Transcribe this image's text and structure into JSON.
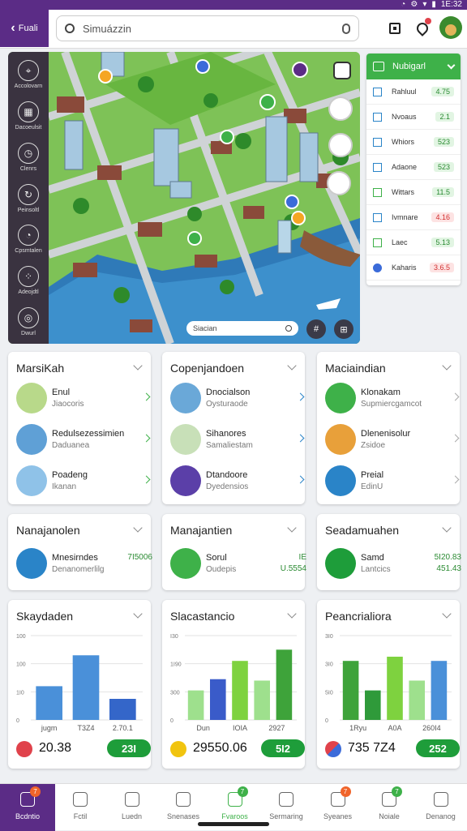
{
  "status": {
    "time": "1E:32"
  },
  "topbar": {
    "back_label": "Fuali",
    "search_placeholder": "Simuázzin"
  },
  "left_rail": [
    {
      "label": "Accolovarn",
      "icon": "compass-icon"
    },
    {
      "label": "Dacoeulsit",
      "icon": "grid-icon"
    },
    {
      "label": "Clenrs",
      "icon": "clock-icon"
    },
    {
      "label": "Peinsoltl",
      "icon": "refresh-icon"
    },
    {
      "label": "Cpsmtalen",
      "icon": "chart-icon"
    },
    {
      "label": "Adeojdtl",
      "icon": "apps-icon"
    },
    {
      "label": "Dwurl",
      "icon": "bell-icon"
    }
  ],
  "map": {
    "search_label": "Siacian"
  },
  "right_panel": {
    "title": "Nubigarl",
    "rows": [
      {
        "label": "Rahluul",
        "value": "4.75",
        "color": "green"
      },
      {
        "label": "Nvoaus",
        "value": "2.1",
        "color": "green"
      },
      {
        "label": "Whiors",
        "value": "523",
        "color": "green"
      },
      {
        "label": "Adaone",
        "value": "523",
        "color": "green"
      },
      {
        "label": "Wittars",
        "value": "11.5",
        "color": "green"
      },
      {
        "label": "Ivmnare",
        "value": "4.16",
        "color": "red"
      },
      {
        "label": "Laec",
        "value": "5.13",
        "color": "green"
      },
      {
        "label": "Kaharis",
        "value": "3.6.5",
        "color": "red"
      }
    ]
  },
  "cards_row1": [
    {
      "title": "MarsiKah",
      "items": [
        {
          "t1": "Enul",
          "t2": "Jiaocoris"
        },
        {
          "t1": "Redulsezessimien",
          "t2": "Daduanea"
        },
        {
          "t1": "Poadeng",
          "t2": "Ikanan"
        }
      ]
    },
    {
      "title": "Copenjandoen",
      "items": [
        {
          "t1": "Dnocialson",
          "t2": "Oysturaode"
        },
        {
          "t1": "Sihanores",
          "t2": "Samaliestam"
        },
        {
          "t1": "Dtandoore",
          "t2": "Dyedensios"
        }
      ]
    },
    {
      "title": "Maciaindian",
      "items": [
        {
          "t1": "Klonakam",
          "t2": "Supmiercgamcot"
        },
        {
          "t1": "Dlenenisolur",
          "t2": "Zsidoe"
        },
        {
          "t1": "Preial",
          "t2": "EdinU"
        }
      ]
    }
  ],
  "cards_row2": [
    {
      "title": "Nanajanolen",
      "t1": "Mnesirndes",
      "t2": "Denanomerlilg",
      "v1": "7I5006",
      "v2": ""
    },
    {
      "title": "Manajantien",
      "t1": "Sorul",
      "t2": "Oudepis",
      "v1": "IE",
      "v2": "U.5554"
    },
    {
      "title": "Seadamuahen",
      "t1": "Samd",
      "t2": "Lantcics",
      "v1": "5I20.83",
      "v2": "451.43"
    }
  ],
  "charts": [
    {
      "title": "Skaydaden",
      "stat": "20.38",
      "pill": "23I",
      "dot_color": "#e0424b"
    },
    {
      "title": "Slacastancio",
      "stat": "29550.06",
      "pill": "5I2",
      "dot_color": "#f1c40f"
    },
    {
      "title": "Peancrialiora",
      "stat": "735  7Z4",
      "pill": "252",
      "dot_color": "#e0424b"
    }
  ],
  "chart_data": [
    {
      "type": "bar",
      "title": "Skaydaden",
      "categories": [
        "jugm",
        "T3Z4",
        "2.70.1"
      ],
      "values": [
        120,
        230,
        75
      ],
      "yticks": [
        "0",
        "1I0",
        "100",
        "100"
      ],
      "ylim": [
        0,
        300
      ],
      "colors": [
        "#4a90d9",
        "#4a90d9",
        "#3466c9"
      ]
    },
    {
      "type": "bar",
      "title": "Slacastancio",
      "categories": [
        "Dun",
        "IOIA",
        "2927"
      ],
      "values": [
        105,
        145,
        210,
        140,
        250
      ],
      "yticks": [
        "0",
        "300",
        "1I90",
        "I30"
      ],
      "ylim": [
        0,
        300
      ],
      "colors": [
        "#9ee08d",
        "#3a5bc9",
        "#7ed23f",
        "#9ee08d",
        "#3ea33a"
      ]
    },
    {
      "type": "bar",
      "title": "Peancrialiora",
      "categories": [
        "1Ryu",
        "A0A",
        "260I4"
      ],
      "values": [
        210,
        105,
        225,
        140,
        210
      ],
      "yticks": [
        "0",
        "5I0",
        "3I0",
        "3I0"
      ],
      "ylim": [
        0,
        300
      ],
      "colors": [
        "#3ea33a",
        "#2f9a3a",
        "#7ed23f",
        "#9ee08d",
        "#4a90d9"
      ]
    }
  ],
  "bottom_nav": [
    {
      "label": "Bcdntio",
      "icon": "bag-icon",
      "active": true,
      "badge": "7",
      "badge_color": "#f0642a"
    },
    {
      "label": "Fctil",
      "icon": "home-icon"
    },
    {
      "label": "Luedn",
      "icon": "user-icon"
    },
    {
      "label": "Snenases",
      "icon": "window-icon"
    },
    {
      "label": "Fvaroos",
      "icon": "users-icon",
      "badge": "7",
      "badge_color": "#3eb149"
    },
    {
      "label": "Sermaring",
      "icon": "search-icon"
    },
    {
      "label": "Syeanes",
      "icon": "store-icon",
      "badge": "7",
      "badge_color": "#f0642a"
    },
    {
      "label": "Noiale",
      "icon": "people-icon",
      "badge": "7",
      "badge_color": "#3eb149"
    },
    {
      "label": "Denanog",
      "icon": "profile-icon"
    }
  ]
}
